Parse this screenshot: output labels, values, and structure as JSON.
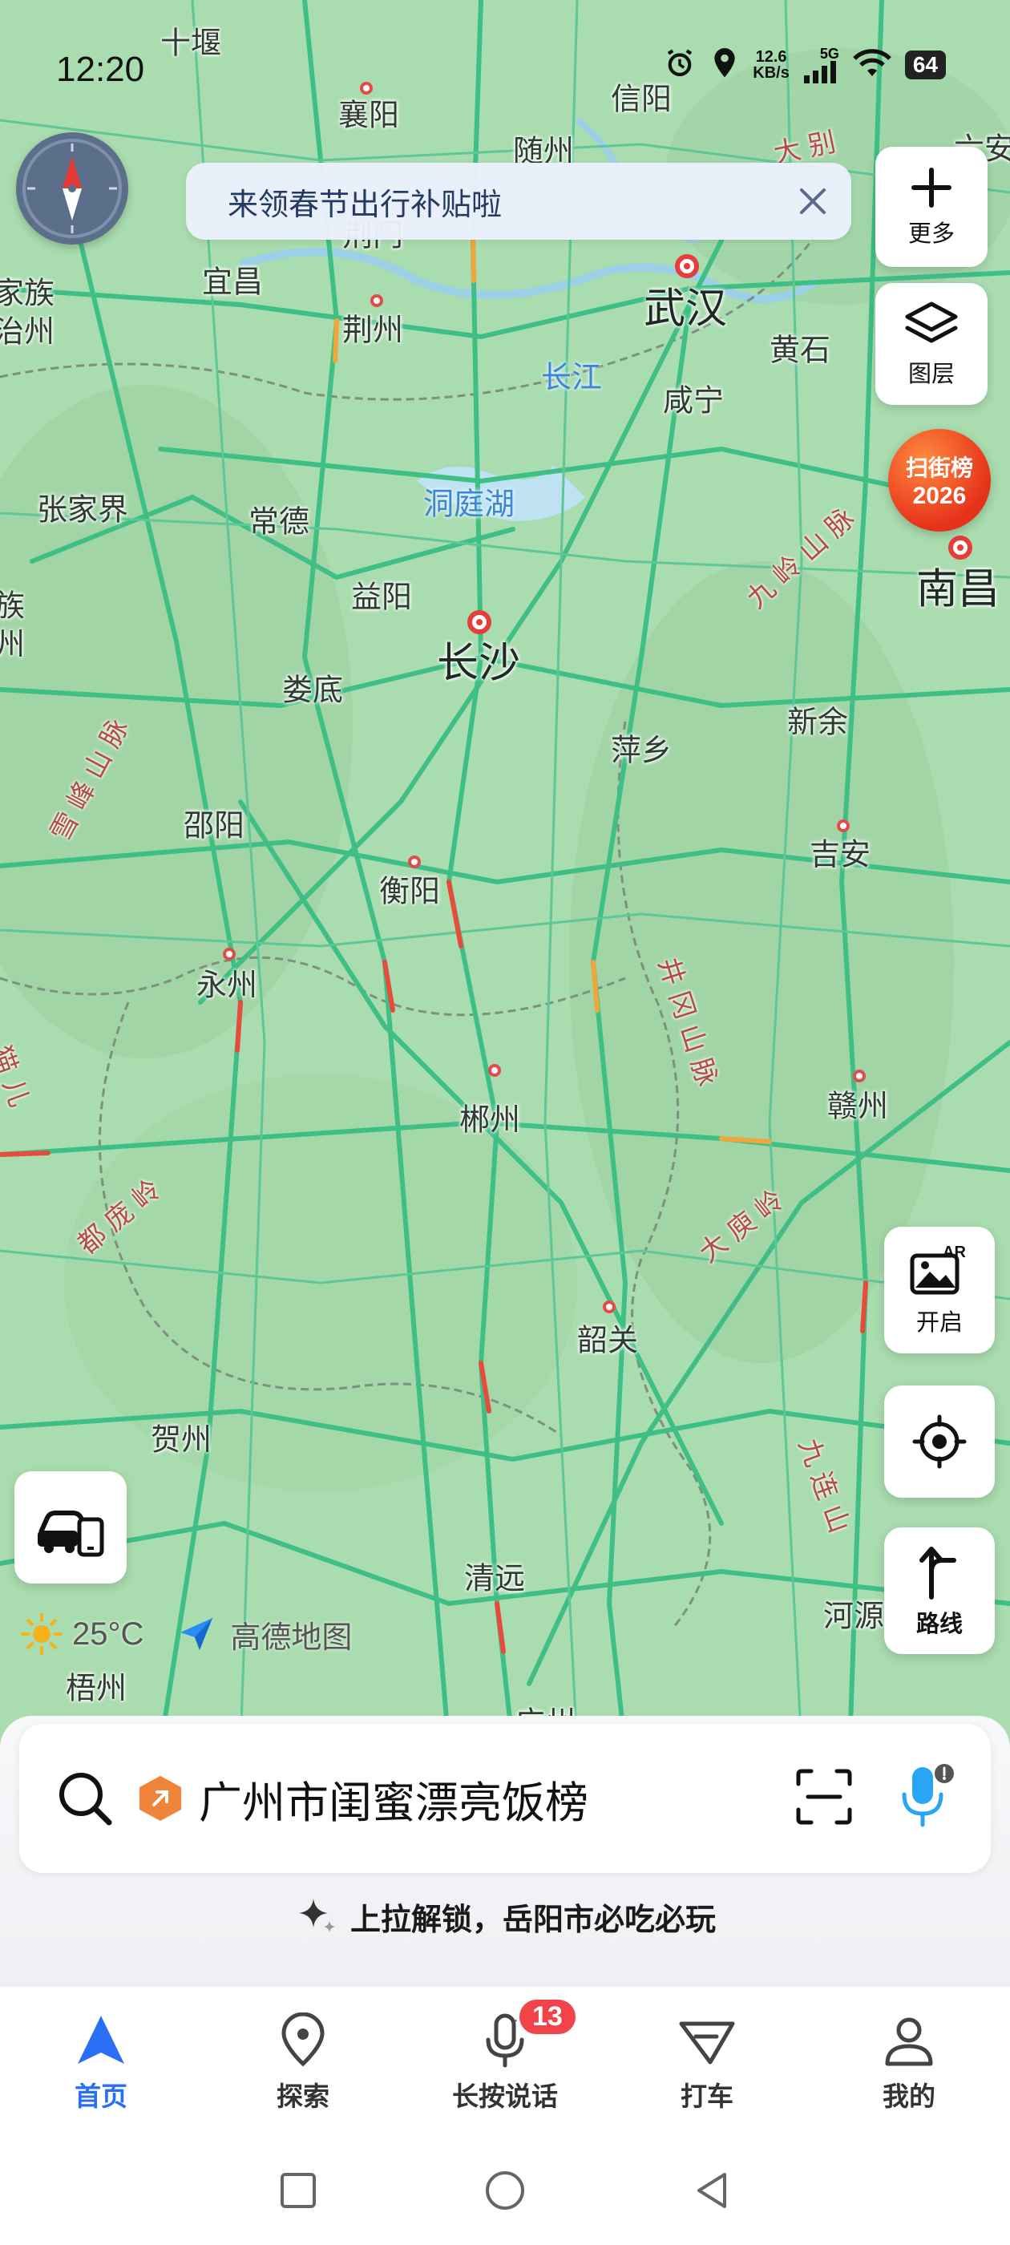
{
  "status_bar": {
    "time": "12:20",
    "net_speed_value": "12.6",
    "net_speed_unit": "KB/s",
    "network": "5G",
    "battery": "64"
  },
  "banner": {
    "text": "来领春节出行补贴啦"
  },
  "toolbar": {
    "more_label": "更多",
    "layers_label": "图层",
    "street_rank_line1": "扫街榜",
    "street_rank_line2": "2026",
    "ar_label": "开启",
    "route_label": "路线"
  },
  "map": {
    "cities": [
      {
        "name": "十堰",
        "big": false
      },
      {
        "name": "襄阳",
        "big": false
      },
      {
        "name": "信阳",
        "big": false
      },
      {
        "name": "随州",
        "big": false
      },
      {
        "name": "荆门",
        "big": false
      },
      {
        "name": "宜昌",
        "big": false
      },
      {
        "name": "武汉",
        "big": true
      },
      {
        "name": "荆州",
        "big": false
      },
      {
        "name": "黄石",
        "big": false
      },
      {
        "name": "咸宁",
        "big": false
      },
      {
        "name": "张家界",
        "big": false
      },
      {
        "name": "常德",
        "big": false
      },
      {
        "name": "南昌",
        "big": true
      },
      {
        "name": "益阳",
        "big": false
      },
      {
        "name": "长沙",
        "big": true
      },
      {
        "name": "娄底",
        "big": false
      },
      {
        "name": "萍乡",
        "big": false
      },
      {
        "name": "新余",
        "big": false
      },
      {
        "name": "邵阳",
        "big": false
      },
      {
        "name": "吉安",
        "big": false
      },
      {
        "name": "衡阳",
        "big": false
      },
      {
        "name": "永州",
        "big": false
      },
      {
        "name": "郴州",
        "big": false
      },
      {
        "name": "赣州",
        "big": false
      },
      {
        "name": "韶关",
        "big": false
      },
      {
        "name": "贺州",
        "big": false
      },
      {
        "name": "清远",
        "big": false
      },
      {
        "name": "河源",
        "big": false
      },
      {
        "name": "梧州",
        "big": false
      },
      {
        "name": "广州",
        "big": false
      },
      {
        "name": "家族",
        "big": false
      },
      {
        "name": "治州",
        "big": false
      },
      {
        "name": "族",
        "big": false
      },
      {
        "name": "州",
        "big": false
      },
      {
        "name": "六安",
        "big": false
      }
    ],
    "waters": [
      "长江",
      "洞庭湖"
    ],
    "mountains": [
      "大别",
      "九岭山脉",
      "雪峰山脉",
      "井冈山脉",
      "都庞岭",
      "大庾岭",
      "九连山",
      "猫儿"
    ]
  },
  "weather": {
    "temperature": "25°C",
    "brand": "高德地图"
  },
  "search": {
    "text": "广州市闺蜜漂亮饭榜"
  },
  "unlock": {
    "text": "上拉解锁，岳阳市必吃必玩"
  },
  "tabs": [
    {
      "label": "首页",
      "active": true
    },
    {
      "label": "探索",
      "active": false
    },
    {
      "label": "长按说话",
      "active": false,
      "badge": "13"
    },
    {
      "label": "打车",
      "active": false
    },
    {
      "label": "我的",
      "active": false
    }
  ],
  "colors": {
    "accent": "#2a6ff3",
    "map_land": "#a9dcae",
    "road": "#3fbf86",
    "badge": "#f0434a"
  }
}
